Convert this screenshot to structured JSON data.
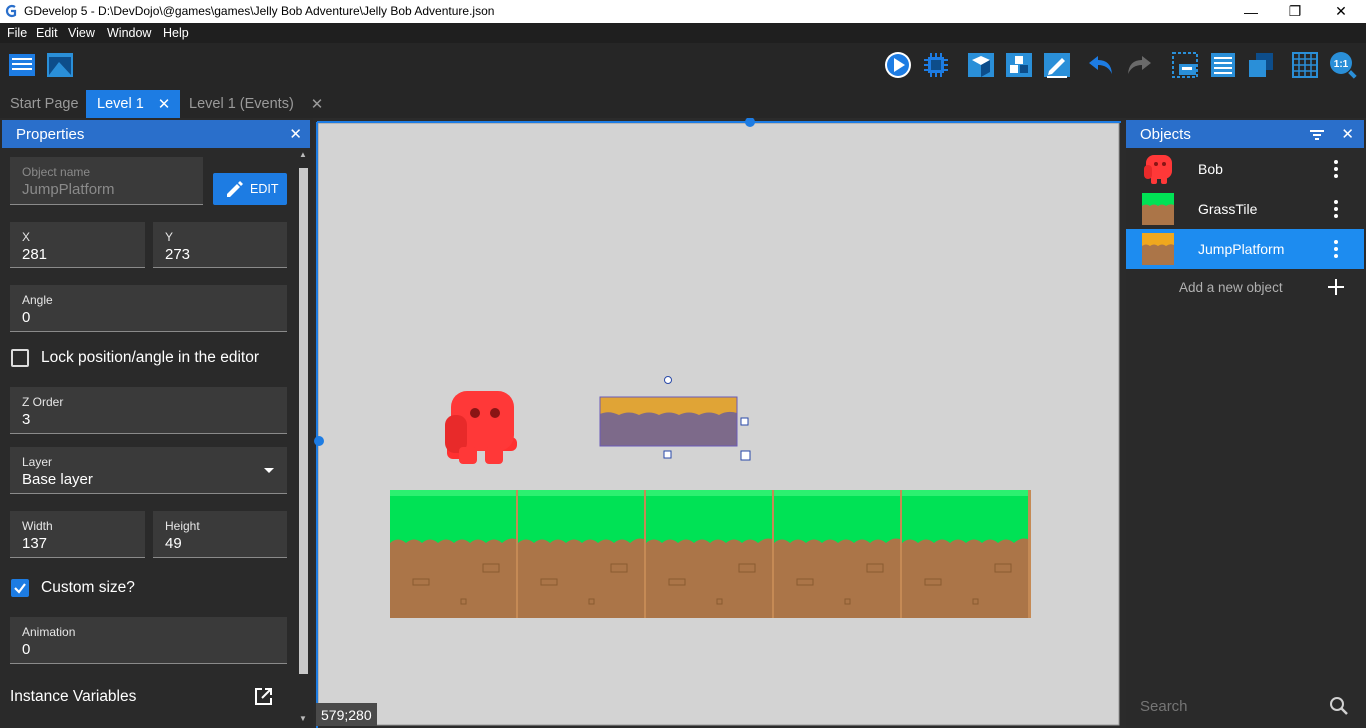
{
  "window": {
    "title": "GDevelop 5 - D:\\DevDojo\\@games\\games\\Jelly Bob Adventure\\Jelly Bob Adventure.json",
    "minimize": "—",
    "restore": "❐",
    "close": "✕"
  },
  "menu": [
    "File",
    "Edit",
    "View",
    "Window",
    "Help"
  ],
  "toolbar": {
    "left_icons": [
      "project-manager-icon",
      "scene-icon"
    ],
    "right_icons": [
      "preview-play-icon",
      "debug-icon",
      "open-instances-icon",
      "objects-groups-icon",
      "properties-edit-icon",
      "undo-icon",
      "redo-icon",
      "layers-icon",
      "instances-list-icon",
      "layout-icon",
      "grid-icon",
      "zoom-reset-icon"
    ]
  },
  "tabs": [
    {
      "label": "Start Page",
      "active": false,
      "closable": false
    },
    {
      "label": "Level 1",
      "active": true,
      "closable": true
    },
    {
      "label": "Level 1 (Events)",
      "active": false,
      "closable": true
    }
  ],
  "properties": {
    "title": "Properties",
    "object_name_label": "Object name",
    "object_name": "JumpPlatform",
    "edit_label": "EDIT",
    "x_label": "X",
    "x": "281",
    "y_label": "Y",
    "y": "273",
    "angle_label": "Angle",
    "angle": "0",
    "lock_label": "Lock position/angle in the editor",
    "lock_checked": false,
    "zorder_label": "Z Order",
    "zorder": "3",
    "layer_label": "Layer",
    "layer": "Base layer",
    "width_label": "Width",
    "width": "137",
    "height_label": "Height",
    "height": "49",
    "custom_size_label": "Custom size?",
    "custom_size_checked": true,
    "animation_label": "Animation",
    "animation": "0",
    "instance_vars_label": "Instance Variables"
  },
  "scene": {
    "cursor_coords": "579;280"
  },
  "objects": {
    "title": "Objects",
    "items": [
      {
        "name": "Bob",
        "selected": false
      },
      {
        "name": "GrassTile",
        "selected": false
      },
      {
        "name": "JumpPlatform",
        "selected": true
      }
    ],
    "add_label": "Add a new object",
    "search_placeholder": "Search"
  },
  "colors": {
    "accent": "#1d7ce3",
    "selected_row": "#1d8cf0",
    "panel_header": "#2a6fcb"
  }
}
